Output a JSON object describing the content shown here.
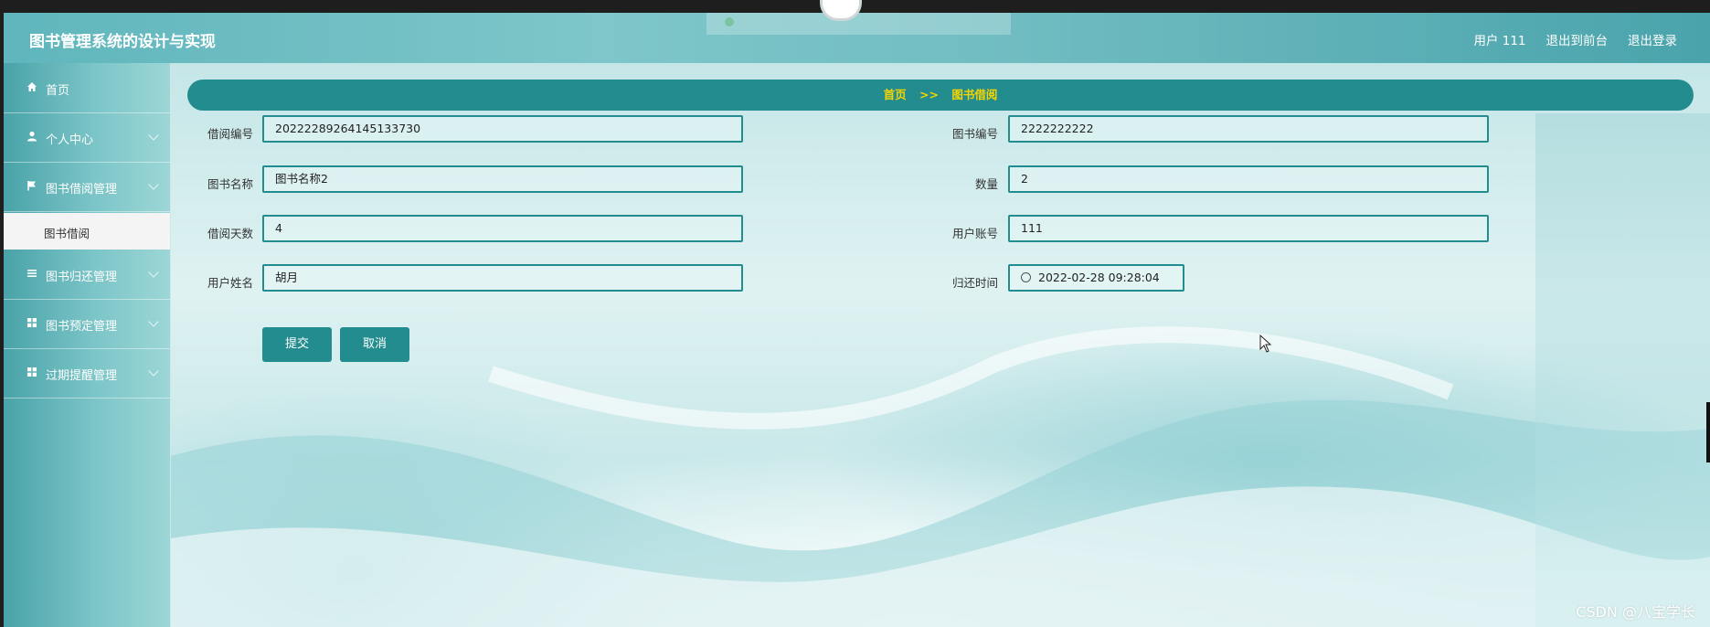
{
  "app": {
    "title": "图书管理系统的设计与实现",
    "user_label": "用户 111",
    "to_front_label": "退出到前台",
    "logout_label": "退出登录"
  },
  "sidebar": {
    "items": [
      {
        "label": "首页",
        "icon": "home-icon"
      },
      {
        "label": "个人中心",
        "icon": "user-icon"
      },
      {
        "label": "图书借阅管理",
        "icon": "flag-icon"
      },
      {
        "label": "图书归还管理",
        "icon": "list-icon"
      },
      {
        "label": "图书预定管理",
        "icon": "grid-icon"
      },
      {
        "label": "过期提醒管理",
        "icon": "grid-icon"
      }
    ],
    "submenu_active": "图书借阅"
  },
  "breadcrumb": {
    "home": "首页",
    "separator": ">>",
    "current": "图书借阅"
  },
  "form": {
    "borrow_no": {
      "label": "借阅编号",
      "value": "20222289264145133730"
    },
    "book_no": {
      "label": "图书编号",
      "value": "2222222222"
    },
    "book_name": {
      "label": "图书名称",
      "value": "图书名称2"
    },
    "quantity": {
      "label": "数量",
      "value": "2"
    },
    "borrow_days": {
      "label": "借阅天数",
      "value": "4"
    },
    "user_account": {
      "label": "用户账号",
      "value": "111"
    },
    "user_name": {
      "label": "用户姓名",
      "value": "胡月"
    },
    "return_time": {
      "label": "归还时间",
      "value": "2022-02-28 09:28:04"
    },
    "submit_label": "提交",
    "cancel_label": "取消"
  },
  "watermark": "CSDN @八宝学长",
  "colors": {
    "accent": "#238c8f",
    "breadcrumb_text": "#f5d400"
  }
}
